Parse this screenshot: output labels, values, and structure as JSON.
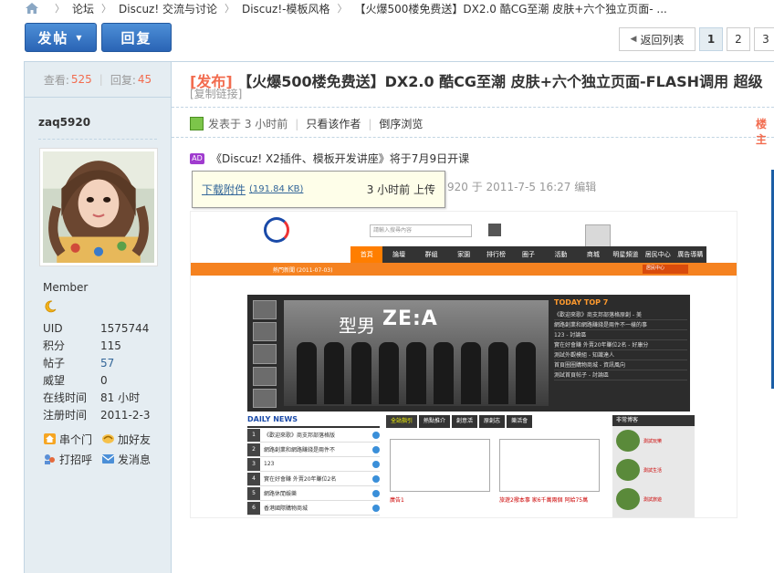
{
  "breadcrumb": {
    "items": [
      "论坛",
      "Discuz! 交流与讨论",
      "Discuz!-模板风格",
      "【火爆500楼免费送】DX2.0 酷CG至潮 皮肤+六个独立页面- ..."
    ]
  },
  "toolbar": {
    "post_label": "发帖",
    "reply_label": "回复"
  },
  "pager": {
    "back_label": "返回列表",
    "pages": [
      "1",
      "2",
      "3"
    ],
    "current": "1"
  },
  "stats": {
    "views_label": "查看:",
    "views": "525",
    "replies_label": "回复:",
    "replies": "45"
  },
  "author": {
    "name": "zaq5920",
    "group": "Member",
    "profile": [
      {
        "key": "UID",
        "value": "1575744"
      },
      {
        "key": "积分",
        "value": "115"
      },
      {
        "key": "帖子",
        "value": "57"
      },
      {
        "key": "威望",
        "value": "0"
      },
      {
        "key": "在线时间",
        "value": "81 小时"
      },
      {
        "key": "注册时间",
        "value": "2011-2-3"
      }
    ],
    "actions": [
      {
        "label": "串个门",
        "icon": "house-icon"
      },
      {
        "label": "加好友",
        "icon": "add-friend-icon"
      },
      {
        "label": "打招呼",
        "icon": "greet-icon"
      },
      {
        "label": "发消息",
        "icon": "mail-icon"
      }
    ]
  },
  "post": {
    "tag": "[发布]",
    "title": "【火爆500楼免费送】DX2.0 酷CG至潮 皮肤+六个独立页面-FLASH调用 超级",
    "copy_link": "[复制链接]",
    "posted_label": "发表于",
    "posted_time": "3 小时前",
    "only_author": "只看该作者",
    "reverse": "倒序浏览",
    "floor": "楼主",
    "ad_text": "《Discuz! X2插件、模板开发讲座》将于7月9日开课",
    "edit_line": "920 于 2011-7-5 16:27 编辑",
    "attachment_label": "下载附件",
    "attachment_size": "(191.84 KB)",
    "attachment_time": "3 小时前 上传"
  },
  "shot": {
    "nav": [
      "首頁",
      "論壇",
      "群組",
      "家園",
      "排行榜",
      "圈子",
      "活動",
      "商城",
      "明星頻道",
      "居民中心",
      "廣告導購"
    ],
    "hot_news": "熱門新聞 (2011-07-03)",
    "center": "居民中心",
    "search_placeholder": "請輸入搜尋內容",
    "banner_cn": "型男",
    "banner_title": "ZE:A",
    "top7_title": "TODAY TOP 7",
    "top7": [
      "《歡迎來歌》商支邦部落格原創 - 美",
      "網路創業和網路賺錢是兩件不一樣的事",
      "123 - 討論區",
      "實在好會賺 外賣20年賺位2名 - 好康分",
      "測試外觀模組 - 知識達人",
      "首頁圈圈購物商城 - 資訊風向",
      "測試首頁帖子 - 討論區"
    ],
    "daily_title": "DAILY NEWS",
    "daily": [
      "《歡迎來歌》商支邦部落格版",
      "網路創業和網路賺錢是兩件不",
      "123",
      "實在好會賺 外賣20年賺位2名",
      "網路休閒娛樂",
      "香港國際購物商城"
    ],
    "mid_tabs": [
      "全站指引",
      "熱點推介",
      "創意活",
      "原創志",
      "樂活會"
    ],
    "mid_caption_1": "廣告1",
    "mid_caption_2": "旅遊2撥本事 家6千萬兩個 阿給75萬",
    "blog_title": "非常博客",
    "blog": [
      "測試玩樂",
      "測試生活",
      "測試旅遊"
    ]
  }
}
